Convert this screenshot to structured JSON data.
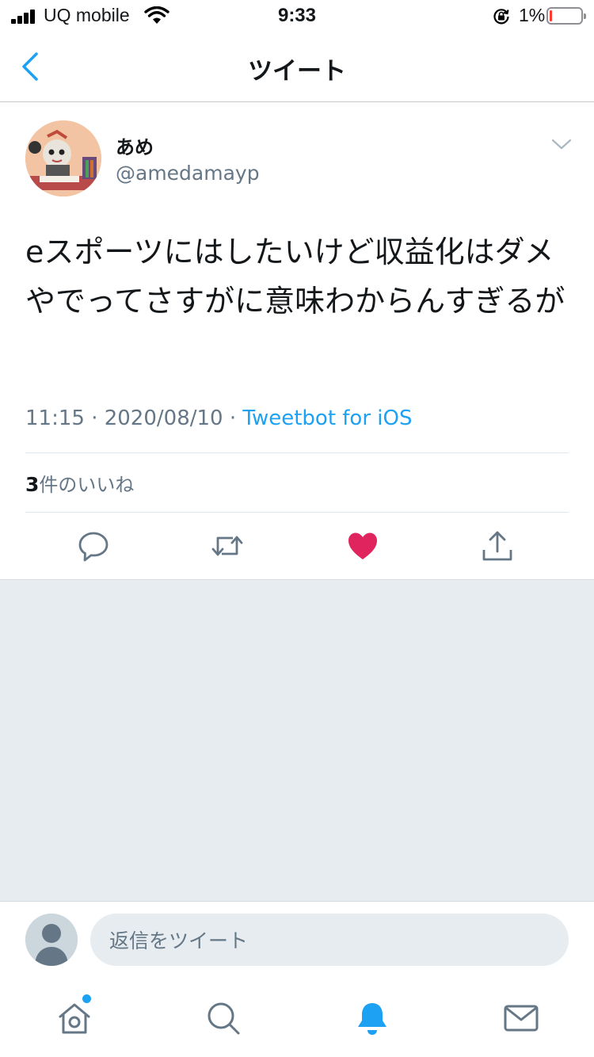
{
  "status_bar": {
    "carrier": "UQ mobile",
    "time": "9:33",
    "battery": "1%"
  },
  "nav": {
    "title": "ツイート",
    "back_icon": "chevron-left-icon"
  },
  "tweet": {
    "name": "あめ",
    "handle": "@amedamayp",
    "text": "eスポーツにはしたいけど収益化はダメやでってさすがに意味わからんすぎるが",
    "timestamp": "11:15 · 2020/08/10 · ",
    "source": "Tweetbot for iOS",
    "like_count": "3",
    "like_label": "件のいいね",
    "liked": true
  },
  "reply": {
    "placeholder": "返信をツイート"
  },
  "tabs": [
    "home-icon",
    "search-icon",
    "notifications-icon",
    "messages-icon"
  ],
  "colors": {
    "accent": "#1da1f2",
    "like": "#e0245e",
    "background": "#e6ecf0",
    "secondary_text": "#657786"
  }
}
